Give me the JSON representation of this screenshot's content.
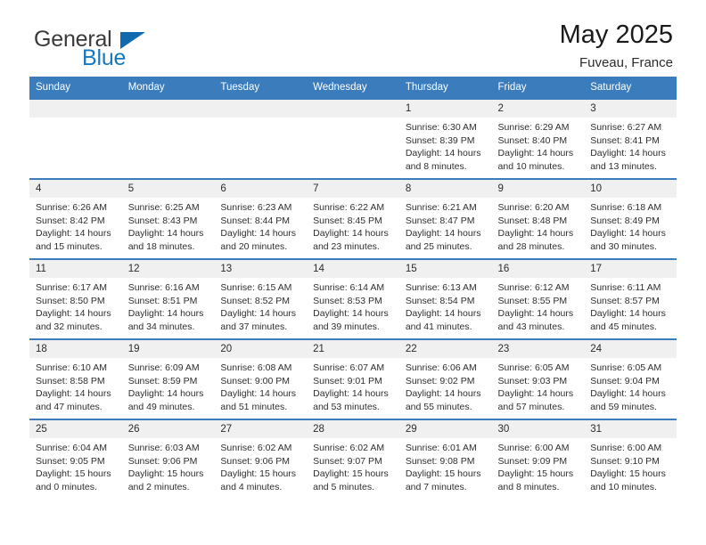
{
  "logo": {
    "primary_text": "General",
    "secondary_text": "Blue",
    "triangle_color": "#1169ae",
    "secondary_color": "#1878be"
  },
  "header": {
    "title": "May 2025",
    "location": "Fuveau, France"
  },
  "theme": {
    "header_blue": "#3b7cbd",
    "daynum_band": "#f0f0f0",
    "text": "#2e2e2e"
  },
  "weekday_headers": [
    "Sunday",
    "Monday",
    "Tuesday",
    "Wednesday",
    "Thursday",
    "Friday",
    "Saturday"
  ],
  "labels": {
    "sunrise_prefix": "Sunrise:",
    "sunset_prefix": "Sunset:",
    "daylight_prefix": "Daylight:"
  },
  "weeks": [
    [
      {
        "day": "",
        "sunrise": "",
        "sunset": "",
        "daylight": "",
        "empty": true
      },
      {
        "day": "",
        "sunrise": "",
        "sunset": "",
        "daylight": "",
        "empty": true
      },
      {
        "day": "",
        "sunrise": "",
        "sunset": "",
        "daylight": "",
        "empty": true
      },
      {
        "day": "",
        "sunrise": "",
        "sunset": "",
        "daylight": "",
        "empty": true
      },
      {
        "day": "1",
        "sunrise": "Sunrise: 6:30 AM",
        "sunset": "Sunset: 8:39 PM",
        "daylight": "Daylight: 14 hours and 8 minutes."
      },
      {
        "day": "2",
        "sunrise": "Sunrise: 6:29 AM",
        "sunset": "Sunset: 8:40 PM",
        "daylight": "Daylight: 14 hours and 10 minutes."
      },
      {
        "day": "3",
        "sunrise": "Sunrise: 6:27 AM",
        "sunset": "Sunset: 8:41 PM",
        "daylight": "Daylight: 14 hours and 13 minutes."
      }
    ],
    [
      {
        "day": "4",
        "sunrise": "Sunrise: 6:26 AM",
        "sunset": "Sunset: 8:42 PM",
        "daylight": "Daylight: 14 hours and 15 minutes."
      },
      {
        "day": "5",
        "sunrise": "Sunrise: 6:25 AM",
        "sunset": "Sunset: 8:43 PM",
        "daylight": "Daylight: 14 hours and 18 minutes."
      },
      {
        "day": "6",
        "sunrise": "Sunrise: 6:23 AM",
        "sunset": "Sunset: 8:44 PM",
        "daylight": "Daylight: 14 hours and 20 minutes."
      },
      {
        "day": "7",
        "sunrise": "Sunrise: 6:22 AM",
        "sunset": "Sunset: 8:45 PM",
        "daylight": "Daylight: 14 hours and 23 minutes."
      },
      {
        "day": "8",
        "sunrise": "Sunrise: 6:21 AM",
        "sunset": "Sunset: 8:47 PM",
        "daylight": "Daylight: 14 hours and 25 minutes."
      },
      {
        "day": "9",
        "sunrise": "Sunrise: 6:20 AM",
        "sunset": "Sunset: 8:48 PM",
        "daylight": "Daylight: 14 hours and 28 minutes."
      },
      {
        "day": "10",
        "sunrise": "Sunrise: 6:18 AM",
        "sunset": "Sunset: 8:49 PM",
        "daylight": "Daylight: 14 hours and 30 minutes."
      }
    ],
    [
      {
        "day": "11",
        "sunrise": "Sunrise: 6:17 AM",
        "sunset": "Sunset: 8:50 PM",
        "daylight": "Daylight: 14 hours and 32 minutes."
      },
      {
        "day": "12",
        "sunrise": "Sunrise: 6:16 AM",
        "sunset": "Sunset: 8:51 PM",
        "daylight": "Daylight: 14 hours and 34 minutes."
      },
      {
        "day": "13",
        "sunrise": "Sunrise: 6:15 AM",
        "sunset": "Sunset: 8:52 PM",
        "daylight": "Daylight: 14 hours and 37 minutes."
      },
      {
        "day": "14",
        "sunrise": "Sunrise: 6:14 AM",
        "sunset": "Sunset: 8:53 PM",
        "daylight": "Daylight: 14 hours and 39 minutes."
      },
      {
        "day": "15",
        "sunrise": "Sunrise: 6:13 AM",
        "sunset": "Sunset: 8:54 PM",
        "daylight": "Daylight: 14 hours and 41 minutes."
      },
      {
        "day": "16",
        "sunrise": "Sunrise: 6:12 AM",
        "sunset": "Sunset: 8:55 PM",
        "daylight": "Daylight: 14 hours and 43 minutes."
      },
      {
        "day": "17",
        "sunrise": "Sunrise: 6:11 AM",
        "sunset": "Sunset: 8:57 PM",
        "daylight": "Daylight: 14 hours and 45 minutes."
      }
    ],
    [
      {
        "day": "18",
        "sunrise": "Sunrise: 6:10 AM",
        "sunset": "Sunset: 8:58 PM",
        "daylight": "Daylight: 14 hours and 47 minutes."
      },
      {
        "day": "19",
        "sunrise": "Sunrise: 6:09 AM",
        "sunset": "Sunset: 8:59 PM",
        "daylight": "Daylight: 14 hours and 49 minutes."
      },
      {
        "day": "20",
        "sunrise": "Sunrise: 6:08 AM",
        "sunset": "Sunset: 9:00 PM",
        "daylight": "Daylight: 14 hours and 51 minutes."
      },
      {
        "day": "21",
        "sunrise": "Sunrise: 6:07 AM",
        "sunset": "Sunset: 9:01 PM",
        "daylight": "Daylight: 14 hours and 53 minutes."
      },
      {
        "day": "22",
        "sunrise": "Sunrise: 6:06 AM",
        "sunset": "Sunset: 9:02 PM",
        "daylight": "Daylight: 14 hours and 55 minutes."
      },
      {
        "day": "23",
        "sunrise": "Sunrise: 6:05 AM",
        "sunset": "Sunset: 9:03 PM",
        "daylight": "Daylight: 14 hours and 57 minutes."
      },
      {
        "day": "24",
        "sunrise": "Sunrise: 6:05 AM",
        "sunset": "Sunset: 9:04 PM",
        "daylight": "Daylight: 14 hours and 59 minutes."
      }
    ],
    [
      {
        "day": "25",
        "sunrise": "Sunrise: 6:04 AM",
        "sunset": "Sunset: 9:05 PM",
        "daylight": "Daylight: 15 hours and 0 minutes."
      },
      {
        "day": "26",
        "sunrise": "Sunrise: 6:03 AM",
        "sunset": "Sunset: 9:06 PM",
        "daylight": "Daylight: 15 hours and 2 minutes."
      },
      {
        "day": "27",
        "sunrise": "Sunrise: 6:02 AM",
        "sunset": "Sunset: 9:06 PM",
        "daylight": "Daylight: 15 hours and 4 minutes."
      },
      {
        "day": "28",
        "sunrise": "Sunrise: 6:02 AM",
        "sunset": "Sunset: 9:07 PM",
        "daylight": "Daylight: 15 hours and 5 minutes."
      },
      {
        "day": "29",
        "sunrise": "Sunrise: 6:01 AM",
        "sunset": "Sunset: 9:08 PM",
        "daylight": "Daylight: 15 hours and 7 minutes."
      },
      {
        "day": "30",
        "sunrise": "Sunrise: 6:00 AM",
        "sunset": "Sunset: 9:09 PM",
        "daylight": "Daylight: 15 hours and 8 minutes."
      },
      {
        "day": "31",
        "sunrise": "Sunrise: 6:00 AM",
        "sunset": "Sunset: 9:10 PM",
        "daylight": "Daylight: 15 hours and 10 minutes."
      }
    ]
  ]
}
